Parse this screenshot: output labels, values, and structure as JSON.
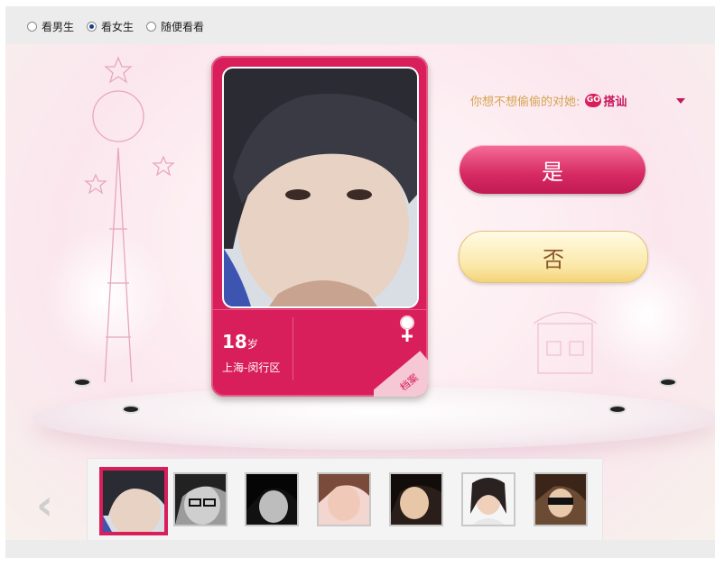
{
  "filters": {
    "options": [
      {
        "label": "看男生",
        "checked": false
      },
      {
        "label": "看女生",
        "checked": true
      },
      {
        "label": "随便看看",
        "checked": false
      }
    ]
  },
  "profile": {
    "age": "18",
    "age_unit": "岁",
    "location": "上海-闵行区",
    "gender": "female",
    "archive_label": "档案"
  },
  "prompt": {
    "question": "你想不想偷偷的对她:",
    "go_badge": "GO",
    "action": "搭讪"
  },
  "buttons": {
    "yes": "是",
    "no": "否"
  },
  "thumbnails": {
    "count": 7,
    "active_index": 0
  },
  "colors": {
    "brand": "#d81e5b",
    "gold": "#d6a350"
  }
}
